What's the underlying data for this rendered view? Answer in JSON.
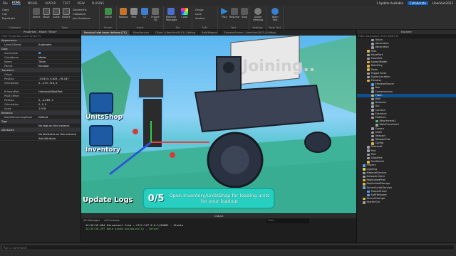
{
  "menubar": {
    "file": "File",
    "tabs": [
      "HOME",
      "MODEL",
      "AVATAR",
      "TEST",
      "VIEW",
      "PLUGINS"
    ],
    "active_tab": "HOME",
    "updates": "1 Update Available",
    "collaborate": "Collaborate",
    "user": "LiberVum2013"
  },
  "ribbon": {
    "clipboard": {
      "items": [
        "Copy",
        "Cut",
        "Duplicate"
      ],
      "paste": "Paste",
      "label": "Clipboard"
    },
    "tools": {
      "buttons": [
        "Select",
        "Move",
        "Scale",
        "Rotate"
      ],
      "mode": "Geometric",
      "opts": [
        "Collisions",
        "Join Surfaces"
      ],
      "label": "Tools"
    },
    "terrain": {
      "buttons": [
        "Editor"
      ],
      "label": "Terrain"
    },
    "insert": {
      "buttons": [
        "Toolbox",
        "Part",
        "UI",
        "Import 3D"
      ],
      "label": "Insert"
    },
    "file": {
      "buttons": [
        "Material Manager",
        "Color"
      ],
      "label": "File"
    },
    "edit": {
      "items": [
        "Group",
        "Lock",
        "Anchor"
      ],
      "label": "Edit"
    },
    "test": {
      "buttons": [
        "Play",
        "Resume",
        "Stop"
      ],
      "label": "Test"
    },
    "settings": {
      "buttons": [
        "Game Settings"
      ],
      "label": "Settings"
    },
    "teamtest": {
      "buttons": [
        "Team Test"
      ],
      "label": "Team Test"
    }
  },
  "properties": {
    "title": "Properties - Model \"Tiltan\"",
    "filter": "Filter Properties (Ctrl+Shift+P)",
    "rows": [
      {
        "type": "sec",
        "k": "Appearance"
      },
      {
        "k": "LevelOfDetail",
        "v": "Automatic"
      },
      {
        "type": "sec",
        "k": "Data"
      },
      {
        "k": "Archivable",
        "v": "",
        "check": true
      },
      {
        "k": "ClassName",
        "v": "Model"
      },
      {
        "k": "Name",
        "v": "Tiltan"
      },
      {
        "k": "Parent",
        "v": "Elevator"
      },
      {
        "type": "sec",
        "k": "Transform"
      },
      {
        "k": "Origin",
        "v": ""
      },
      {
        "k": "Position",
        "v": "-13.614, 0.625, -78.187"
      },
      {
        "k": "Orientation",
        "v": "0, -170, 720, 0"
      },
      {
        "k": "",
        "v": ""
      },
      {
        "k": "PrimaryPart",
        "v": "HumanoidRootPart"
      },
      {
        "k": "Pivot Offset",
        "v": ""
      },
      {
        "k": "Position",
        "v": "0, -4.089, 0"
      },
      {
        "k": "Orientation",
        "v": "0, 0, 0"
      },
      {
        "k": "Scale",
        "v": "1.978"
      },
      {
        "type": "sec",
        "k": "Behavior"
      },
      {
        "k": "ModelStreamingMode",
        "v": "Default"
      },
      {
        "type": "sec",
        "k": "Tags"
      },
      {
        "k": "",
        "v": "No tags on this instance"
      },
      {
        "type": "sec",
        "k": "Attributes"
      },
      {
        "k": "",
        "v": "No attributes on this instance"
      },
      {
        "k": "",
        "v": "Add Attribute"
      }
    ]
  },
  "doctabs": [
    "Revolusi tolet tower defense [TE]",
    "ShopService",
    "Client | LiberVum2013 | Editing",
    "SafeTeleport",
    "ElevatorServer | LiberVum2013 | Editing"
  ],
  "viewport": {
    "units_shop": "UnitsShop",
    "inventory": "Inventory",
    "update_logs": "Update Logs",
    "sign_text": "Joining..",
    "banner_count": "0/5",
    "banner_msg": "Open Inventory/UnitsShop for loading units for your loadout"
  },
  "output": {
    "title": "Output",
    "tools": [
      "All Messages",
      "All Contexts"
    ],
    "filter_placeholder": "Filter...",
    "lines": [
      {
        "text": "14:55:55.604  Disconnect from ::ffff:127.0.0.1|50001  -  Studio",
        "color": "#e0e0e0"
      },
      {
        "text": "14:55:56.297  Data saved successfully  -  Server",
        "color": "#6fd36f"
      }
    ]
  },
  "explorer": {
    "title": "Explorer",
    "filter": "Filter workspace (Ctrl+Shift+X)",
    "items": [
      {
        "name": "Union",
        "indent": 3,
        "color": "#9aa0a6"
      },
      {
        "name": "decoration",
        "indent": 3,
        "color": "#9aa0a6"
      },
      {
        "name": "decoration",
        "indent": 3,
        "color": "#9aa0a6"
      },
      {
        "name": "Path",
        "indent": 2,
        "color": "#e3b341"
      },
      {
        "name": "MovePart",
        "indent": 2,
        "color": "#9aa0a6"
      },
      {
        "name": "ShopPart",
        "indent": 2,
        "color": "#9aa0a6"
      },
      {
        "name": "SpawnModel",
        "indent": 2,
        "color": "#e3b341"
      },
      {
        "name": "ToiletCity",
        "indent": 2,
        "color": "#e3b341"
      },
      {
        "name": "Trees",
        "indent": 2,
        "color": "#e3b341"
      },
      {
        "name": "TriggerGiver",
        "indent": 2,
        "color": "#9aa0a6"
      },
      {
        "name": "SpawnLocation",
        "indent": 2,
        "color": "#9aa0a6"
      },
      {
        "name": "Elevator",
        "indent": 2,
        "color": "#e3b341"
      },
      {
        "name": "ElevatorServer",
        "indent": 3,
        "color": "#59a3f0"
      },
      {
        "name": "Box",
        "indent": 3,
        "color": "#9aa0a6"
      },
      {
        "name": "Crossfunction",
        "indent": 3,
        "color": "#9aa0a6"
      },
      {
        "name": "Tiltan",
        "indent": 3,
        "color": "#e3b341",
        "sel": true
      },
      {
        "name": "Wall",
        "indent": 3,
        "color": "#9aa0a6"
      },
      {
        "name": "Detector",
        "indent": 3,
        "color": "#9aa0a6"
      },
      {
        "name": "Gui",
        "indent": 3,
        "color": "#9aa0a6"
      },
      {
        "name": "Camera",
        "indent": 3,
        "color": "#9aa0a6"
      },
      {
        "name": "Entrance",
        "indent": 3,
        "color": "#9aa0a6"
      },
      {
        "name": "Platform",
        "indent": 3,
        "color": "#9aa0a6"
      },
      {
        "name": "Attachment1",
        "indent": 4,
        "color": "#4fc36f"
      },
      {
        "name": "WeldConstraint",
        "indent": 4,
        "color": "#9aa0a6"
      },
      {
        "name": "Screen",
        "indent": 3,
        "color": "#9aa0a6"
      },
      {
        "name": "Shaft",
        "indent": 3,
        "color": "#9aa0a6"
      },
      {
        "name": "Teleport",
        "indent": 3,
        "color": "#9aa0a6"
      },
      {
        "name": "TeleportOut",
        "indent": 3,
        "color": "#9aa0a6"
      },
      {
        "name": "Config",
        "indent": 3,
        "color": "#e3b341"
      },
      {
        "name": "FakeLoaf",
        "indent": 2,
        "color": "#9aa0a6"
      },
      {
        "name": "Part",
        "indent": 2,
        "color": "#9aa0a6"
      },
      {
        "name": "Part",
        "indent": 2,
        "color": "#9aa0a6"
      },
      {
        "name": "ShopPart",
        "indent": 2,
        "color": "#9aa0a6"
      },
      {
        "name": "TreeModel",
        "indent": 2,
        "color": "#e3b341"
      },
      {
        "name": "Players",
        "indent": 1,
        "color": "#59a3f0"
      },
      {
        "name": "Lighting",
        "indent": 1,
        "color": "#e3d441"
      },
      {
        "name": "MaterialService",
        "indent": 1,
        "color": "#9aa0a6"
      },
      {
        "name": "NetworkClient",
        "indent": 1,
        "color": "#9aa0a6"
      },
      {
        "name": "ReplicatedFirst",
        "indent": 1,
        "color": "#e3b341"
      },
      {
        "name": "ReplicatedStorage",
        "indent": 1,
        "color": "#e3b341"
      },
      {
        "name": "ServerScriptService",
        "indent": 1,
        "color": "#59a3f0"
      },
      {
        "name": "ShopService",
        "indent": 2,
        "color": "#59a3f0"
      },
      {
        "name": "SafeTeleport",
        "indent": 2,
        "color": "#59a3f0"
      },
      {
        "name": "ServerStorage",
        "indent": 1,
        "color": "#e3b341"
      },
      {
        "name": "StarterGui",
        "indent": 1,
        "color": "#9aa0a6"
      }
    ]
  },
  "commandbar": {
    "placeholder": "Run a command"
  }
}
